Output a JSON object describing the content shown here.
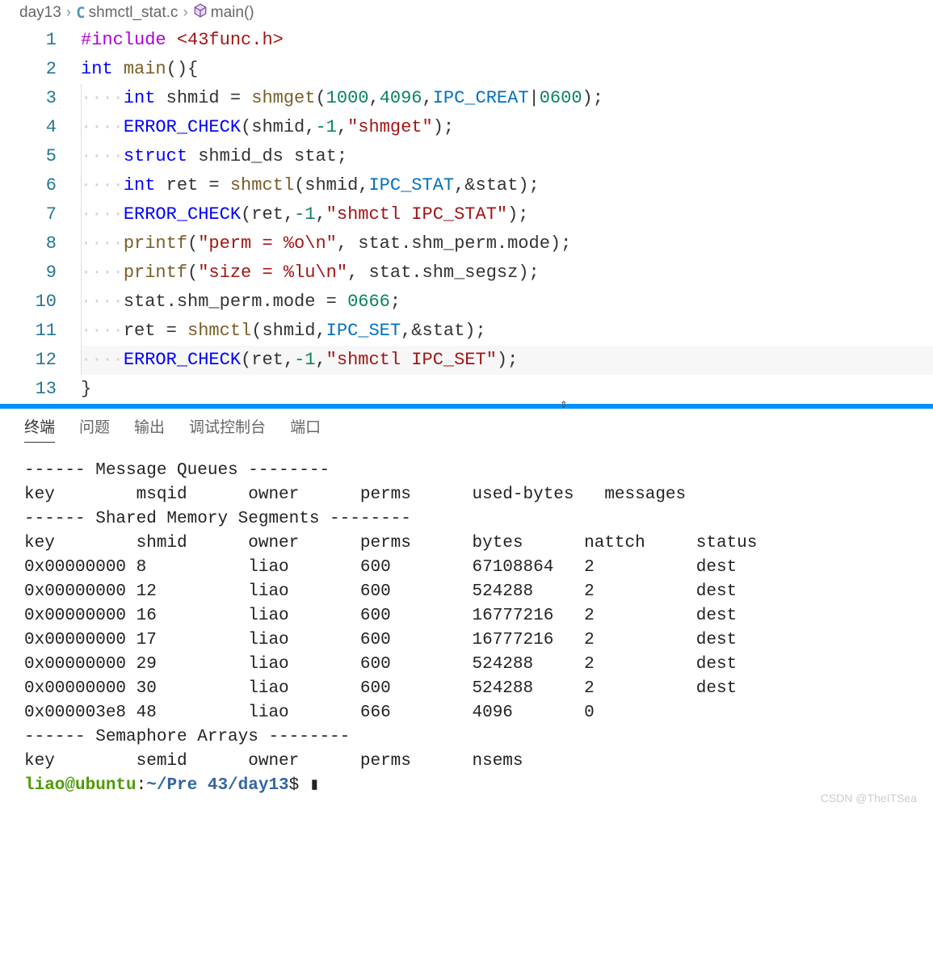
{
  "breadcrumb": {
    "folder": "day13",
    "file": "shmctl_stat.c",
    "symbol": "main()"
  },
  "code": {
    "lines": [
      {
        "n": 1,
        "indent": 0,
        "tokens": [
          [
            "kw-include",
            "#include"
          ],
          [
            "punct",
            " "
          ],
          [
            "angle",
            "<43func.h>"
          ]
        ]
      },
      {
        "n": 2,
        "indent": 0,
        "tokens": [
          [
            "kw-type",
            "int"
          ],
          [
            "punct",
            " "
          ],
          [
            "fn-name",
            "main"
          ],
          [
            "punct",
            "(){"
          ]
        ]
      },
      {
        "n": 3,
        "indent": 1,
        "tokens": [
          [
            "kw-type",
            "int"
          ],
          [
            "punct",
            " shmid = "
          ],
          [
            "fn-name",
            "shmget"
          ],
          [
            "punct",
            "("
          ],
          [
            "num",
            "1000"
          ],
          [
            "punct",
            ","
          ],
          [
            "num",
            "4096"
          ],
          [
            "punct",
            ","
          ],
          [
            "const-blue",
            "IPC_CREAT"
          ],
          [
            "punct",
            "|"
          ],
          [
            "num",
            "0600"
          ],
          [
            "punct",
            ");"
          ]
        ]
      },
      {
        "n": 4,
        "indent": 1,
        "tokens": [
          [
            "macro",
            "ERROR_CHECK"
          ],
          [
            "punct",
            "(shmid,"
          ],
          [
            "num",
            "-1"
          ],
          [
            "punct",
            ","
          ],
          [
            "str",
            "\"shmget\""
          ],
          [
            "punct",
            ");"
          ]
        ]
      },
      {
        "n": 5,
        "indent": 1,
        "tokens": [
          [
            "kw-type",
            "struct"
          ],
          [
            "punct",
            " "
          ],
          [
            "punct",
            "shmid_ds stat;"
          ]
        ]
      },
      {
        "n": 6,
        "indent": 1,
        "tokens": [
          [
            "kw-type",
            "int"
          ],
          [
            "punct",
            " ret = "
          ],
          [
            "fn-name",
            "shmctl"
          ],
          [
            "punct",
            "(shmid,"
          ],
          [
            "const-blue",
            "IPC_STAT"
          ],
          [
            "punct",
            ",&stat);"
          ]
        ]
      },
      {
        "n": 7,
        "indent": 1,
        "tokens": [
          [
            "macro",
            "ERROR_CHECK"
          ],
          [
            "punct",
            "(ret,"
          ],
          [
            "num",
            "-1"
          ],
          [
            "punct",
            ","
          ],
          [
            "str",
            "\"shmctl IPC_STAT\""
          ],
          [
            "punct",
            ");"
          ]
        ]
      },
      {
        "n": 8,
        "indent": 1,
        "tokens": [
          [
            "fn-name",
            "printf"
          ],
          [
            "punct",
            "("
          ],
          [
            "str",
            "\"perm = %o\\n\""
          ],
          [
            "punct",
            ", stat.shm_perm.mode);"
          ]
        ]
      },
      {
        "n": 9,
        "indent": 1,
        "tokens": [
          [
            "fn-name",
            "printf"
          ],
          [
            "punct",
            "("
          ],
          [
            "str",
            "\"size = %lu\\n\""
          ],
          [
            "punct",
            ", stat.shm_segsz);"
          ]
        ]
      },
      {
        "n": 10,
        "indent": 1,
        "tokens": [
          [
            "punct",
            "stat.shm_perm.mode = "
          ],
          [
            "num",
            "0666"
          ],
          [
            "punct",
            ";"
          ]
        ]
      },
      {
        "n": 11,
        "indent": 1,
        "tokens": [
          [
            "punct",
            "ret = "
          ],
          [
            "fn-name",
            "shmctl"
          ],
          [
            "punct",
            "(shmid,"
          ],
          [
            "const-blue",
            "IPC_SET"
          ],
          [
            "punct",
            ",&stat);"
          ]
        ]
      },
      {
        "n": 12,
        "indent": 1,
        "hl": true,
        "tokens": [
          [
            "macro",
            "ERROR_CHECK"
          ],
          [
            "punct",
            "(ret,"
          ],
          [
            "num",
            "-1"
          ],
          [
            "punct",
            ","
          ],
          [
            "str",
            "\"shmctl IPC_SET\""
          ],
          [
            "punct",
            ");"
          ]
        ]
      },
      {
        "n": 13,
        "indent": 0,
        "tokens": [
          [
            "punct",
            "}"
          ]
        ]
      }
    ]
  },
  "panel": {
    "tabs": [
      "终端",
      "问题",
      "输出",
      "调试控制台",
      "端口"
    ],
    "active": 0
  },
  "terminal": {
    "msg_header": "------ Message Queues --------",
    "msg_cols": "key        msqid      owner      perms      used-bytes   messages",
    "shm_header": "------ Shared Memory Segments --------",
    "shm_cols": "key        shmid      owner      perms      bytes      nattch     status",
    "shm_rows": [
      "0x00000000 8          liao       600        67108864   2          dest",
      "0x00000000 12         liao       600        524288     2          dest",
      "0x00000000 16         liao       600        16777216   2          dest",
      "0x00000000 17         liao       600        16777216   2          dest",
      "0x00000000 29         liao       600        524288     2          dest",
      "0x00000000 30         liao       600        524288     2          dest",
      "0x000003e8 48         liao       666        4096       0"
    ],
    "sem_header": "------ Semaphore Arrays --------",
    "sem_cols": "key        semid      owner      perms      nsems",
    "prompt_user": "liao@ubuntu",
    "prompt_colon": ":",
    "prompt_path": "~/Pre 43/day13",
    "prompt_end": "$ ",
    "cursor": "▮"
  },
  "watermark": "CSDN @TheITSea"
}
